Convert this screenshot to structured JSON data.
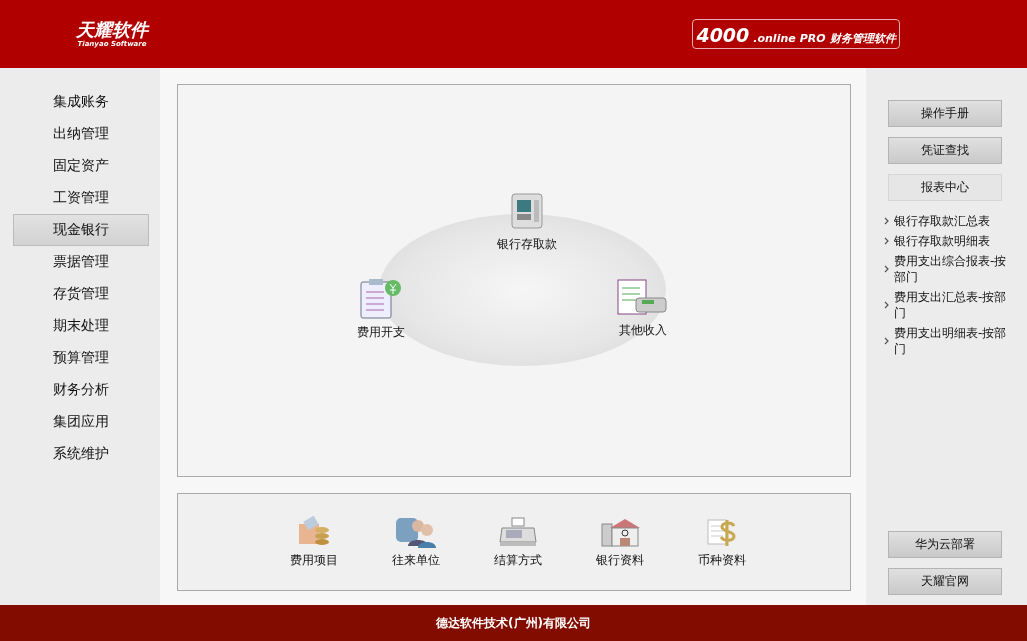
{
  "header": {
    "logo": {
      "name": "天耀软件",
      "subtitle": "Tianyao Software"
    },
    "product": {
      "number": "4000",
      "suffix": ".online",
      "edition": "PRO",
      "title": "财务管理软件"
    }
  },
  "sidebar": {
    "items": [
      {
        "label": "集成账务",
        "selected": false
      },
      {
        "label": "出纳管理",
        "selected": false
      },
      {
        "label": "固定资产",
        "selected": false
      },
      {
        "label": "工资管理",
        "selected": false
      },
      {
        "label": "现金银行",
        "selected": true
      },
      {
        "label": "票据管理",
        "selected": false
      },
      {
        "label": "存货管理",
        "selected": false
      },
      {
        "label": "期末处理",
        "selected": false
      },
      {
        "label": "预算管理",
        "selected": false
      },
      {
        "label": "财务分析",
        "selected": false
      },
      {
        "label": "集团应用",
        "selected": false
      },
      {
        "label": "系统维护",
        "selected": false
      }
    ]
  },
  "flow": {
    "nodes": [
      {
        "label": "银行存取款",
        "kind": "atm"
      },
      {
        "label": "费用开支",
        "kind": "expense"
      },
      {
        "label": "其他收入",
        "kind": "pos"
      }
    ]
  },
  "basics": {
    "items": [
      {
        "label": "费用项目",
        "kind": "coins"
      },
      {
        "label": "往来单位",
        "kind": "people"
      },
      {
        "label": "结算方式",
        "kind": "register"
      },
      {
        "label": "银行资料",
        "kind": "bank"
      },
      {
        "label": "币种资料",
        "kind": "dollar"
      }
    ]
  },
  "tools": {
    "buttons": [
      {
        "label": "操作手册",
        "selected": false
      },
      {
        "label": "凭证查找",
        "selected": false
      },
      {
        "label": "报表中心",
        "selected": true
      }
    ],
    "reports": [
      "银行存取款汇总表",
      "银行存取款明细表",
      "费用支出综合报表-按部门",
      "费用支出汇总表-按部门",
      "费用支出明细表-按部门"
    ],
    "links": [
      "华为云部署",
      "天耀官网"
    ]
  },
  "footer": {
    "company": "德达软件技术(广州)有限公司"
  }
}
